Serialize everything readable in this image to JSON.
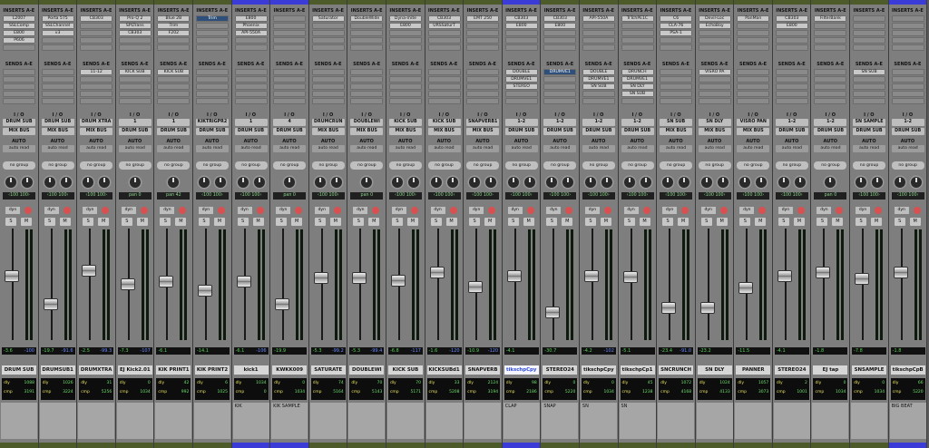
{
  "section_labels": {
    "inserts": "INSERTS A-E",
    "sends": "SENDS A-E",
    "io": "I / O",
    "dyn": "dyn",
    "solo": "S",
    "mute": "M",
    "dly": "dly",
    "cmp": "cmp"
  },
  "colors": {
    "blue": "#3b3bd8",
    "olive": "#4d5a2a",
    "sel": "#2d4f7a"
  },
  "tracks": [
    {
      "name": "DRUM SUB",
      "bar": "olive",
      "inserts": [
        "L2007",
        "SSLComp",
        "E800",
        "P606"
      ],
      "sends": [],
      "input": "DRUM SUB",
      "output": "MIX BUS",
      "auto": "AUTO",
      "mode": "auto read",
      "group": "no group",
      "pan": "‹100  100›",
      "vol": "-3.6",
      "peak": "-100",
      "fader": 0.58,
      "dly": "1088",
      "cmp": "3191",
      "dly2": "1024",
      "cmp2": "3191",
      "comment": ""
    },
    {
      "name": "DRUMSUB1",
      "bar": "olive",
      "inserts": [
        "Porta 575",
        "SSLChannel",
        "v3"
      ],
      "sends": [],
      "input": "DRUM SUB",
      "output": "MIX BUS",
      "auto": "AUTO",
      "mode": "auto read",
      "group": "no group",
      "pan": "‹100  100›",
      "vol": "-19.7",
      "peak": "-91.6",
      "fader": 0.3,
      "dly": "1026",
      "cmp": "3224",
      "comment": ""
    },
    {
      "name": "DRUMXTRA",
      "bar": "olive",
      "inserts": [
        "CB303"
      ],
      "sends": [
        "11-12"
      ],
      "input": "DRUM XTRA",
      "output": "MIX BUS",
      "auto": "AUTO",
      "mode": "auto read",
      "group": "no group",
      "pan": "‹100  100›",
      "vol": "-2.5",
      "peak": "-99.3",
      "fader": 0.63,
      "dly": "31",
      "cmp": "5256",
      "comment": ""
    },
    {
      "name": "EJ Kick2.01",
      "bar": "olive",
      "inserts": [
        "Pro-Q 2",
        "SPLTrans",
        "CB303"
      ],
      "sends": [
        "KICK SUB"
      ],
      "input": "1",
      "output": "DRUM SUB",
      "auto": "AUTO",
      "mode": "auto read",
      "group": "no group",
      "pan": "pan  0",
      "vol": "-7.3",
      "peak": "-107",
      "fader": 0.5,
      "dly": "0",
      "cmp": "1034",
      "comment": ""
    },
    {
      "name": "KIK PRINT1",
      "bar": "olive",
      "inserts": [
        "Blue 2B",
        "Trim",
        "F202"
      ],
      "sends": [
        "KICK SUB"
      ],
      "input": "1",
      "output": "DRUM SUB",
      "auto": "AUTO",
      "mode": "auto read",
      "group": "no group",
      "pan": "pan  42",
      "vol": "-6.1",
      "peak": "",
      "fader": 0.53,
      "dly": "42",
      "cmp": "992",
      "comment": ""
    },
    {
      "name": "KIK PRINT2",
      "bar": "olive",
      "inserts": [
        "Trim"
      ],
      "sends": [],
      "input": "KIKTRIGPR2",
      "output": "DRUM SUB",
      "auto": "AUTO",
      "mode": "auto read",
      "group": "no group",
      "pan": "‹100  100›",
      "vol": "-14.1",
      "peak": "",
      "fader": 0.44,
      "dly": "6",
      "cmp": "1025",
      "comment": "",
      "selIns": true
    },
    {
      "name": "kick1",
      "bar": "blue",
      "inserts": [
        "E800",
        "Phoenix",
        "API-550A"
      ],
      "sends": [],
      "input": "1",
      "output": "DRUM SUB",
      "auto": "AUTO",
      "mode": "auto read",
      "group": "no group",
      "pan": "‹100  100›",
      "vol": "-6.1",
      "peak": "-106",
      "fader": 0.53,
      "dly": "1034",
      "cmp": "0",
      "comment": "KIK"
    },
    {
      "name": "KWKK009",
      "bar": "blue",
      "inserts": [],
      "sends": [],
      "input": "4",
      "output": "DRUM SUB",
      "auto": "AUTO",
      "mode": "auto read",
      "group": "no group",
      "pan": "pan  0",
      "vol": "-19.9",
      "peak": "",
      "fader": 0.3,
      "dly": "0",
      "cmp": "1034",
      "comment": "KIK SAMPLE"
    },
    {
      "name": "SATURATE",
      "bar": "olive",
      "inserts": [
        "Saturator"
      ],
      "sends": [],
      "input": "DRUMCRUN",
      "output": "MIX BUS",
      "auto": "AUTO",
      "mode": "auto read",
      "group": "no group",
      "pan": "‹100  100›",
      "vol": "-5.3",
      "peak": "-99.2",
      "fader": 0.56,
      "dly": "74",
      "cmp": "5164",
      "comment": ""
    },
    {
      "name": "DOUBLEWI",
      "bar": "olive",
      "inserts": [
        "DoubleWide"
      ],
      "sends": [],
      "input": "DOUBLEWI",
      "output": "MIX BUS",
      "auto": "AUTO",
      "mode": "auto read",
      "group": "no group",
      "pan": "pan  0",
      "vol": "-5.3",
      "peak": "-99.4",
      "fader": 0.56,
      "dly": "70",
      "cmp": "5143",
      "comment": ""
    },
    {
      "name": "KICK SUB",
      "bar": "olive",
      "inserts": [
        "Dyna-mite",
        "E800"
      ],
      "sends": [],
      "input": "KICK SUB",
      "output": "MIX BUS",
      "auto": "AUTO",
      "mode": "auto read",
      "group": "no group",
      "pan": "‹100  100›",
      "vol": "-6.8",
      "peak": "-117",
      "fader": 0.54,
      "dly": "70",
      "cmp": "5171",
      "comment": ""
    },
    {
      "name": "KICKSUBd1",
      "bar": "olive",
      "inserts": [
        "CB303",
        "URSSaturT"
      ],
      "sends": [],
      "input": "KICK SUB",
      "output": "MIX BUS",
      "auto": "AUTO",
      "mode": "auto read",
      "group": "no group",
      "pan": "‹100  100›",
      "vol": "-1.6",
      "peak": "-120",
      "fader": 0.62,
      "dly": "33",
      "cmp": "5208",
      "comment": ""
    },
    {
      "name": "SNAPVERB",
      "bar": "olive",
      "inserts": [
        "EMT 250"
      ],
      "sends": [],
      "input": "SNAPVERB1",
      "output": "MIX BUS",
      "auto": "AUTO",
      "mode": "auto read",
      "group": "no group",
      "pan": "‹100  100›",
      "vol": "-10.9",
      "peak": "-120",
      "fader": 0.47,
      "dly": "2124",
      "cmp": "3194",
      "comment": ""
    },
    {
      "name": "tikschpCpy",
      "bar": "blue",
      "inserts": [
        "CB303",
        "E800"
      ],
      "sends": [
        "DOUBLE",
        "DRUMVE1",
        "STEREO"
      ],
      "input": "1-2",
      "output": "DRUM SUB",
      "auto": "AUTO",
      "mode": "auto read",
      "group": "no group",
      "pan": "‹100  100›",
      "vol": "-4.1",
      "peak": "",
      "fader": 0.58,
      "dly": "98",
      "cmp": "2186",
      "comment": "CLAP",
      "selName": true
    },
    {
      "name": "STEREO24",
      "bar": "olive",
      "inserts": [
        "CB303",
        "E800"
      ],
      "sends": [
        "DRUMVE1"
      ],
      "input": "1-2",
      "output": "DRUM SUB",
      "auto": "AUTO",
      "mode": "auto read",
      "group": "no group",
      "pan": "‹100  100›",
      "vol": "-30.7",
      "peak": "",
      "fader": 0.22,
      "dly": "0",
      "cmp": "5220",
      "comment": "SNAP",
      "selSend": true
    },
    {
      "name": "tikschpCpy",
      "bar": "olive",
      "inserts": [
        "API-550A"
      ],
      "sends": [
        "DOUBLE",
        "DRUMVE1",
        "SN SUB"
      ],
      "input": "1-2",
      "output": "DRUM SUB",
      "auto": "AUTO",
      "mode": "auto read",
      "group": "no group",
      "pan": "‹100  100›",
      "vol": "-4.2",
      "peak": "-102",
      "fader": 0.58,
      "dly": "0",
      "cmp": "1034",
      "comment": "SN"
    },
    {
      "name": "tikschpCp1",
      "bar": "olive",
      "inserts": [
        "TrTchPE1C"
      ],
      "sends": [
        "DRUNCH",
        "DRUMVE1",
        "SN DLY",
        "SN SUB"
      ],
      "input": "1-2",
      "output": "DRUM SUB",
      "auto": "AUTO",
      "mode": "auto read",
      "group": "no group",
      "pan": "‹100  100›",
      "vol": "-5.1",
      "peak": "",
      "fader": 0.57,
      "dly": "45",
      "cmp": "1238",
      "comment": "SN"
    },
    {
      "name": "SNCRUNCH",
      "bar": "olive",
      "inserts": [
        "C6",
        "CLA-76",
        "PSA-1"
      ],
      "sends": [],
      "input": "SN SUB",
      "output": "MIX BUS",
      "auto": "AUTO",
      "mode": "auto read",
      "group": "no group",
      "pan": "‹100  100›",
      "vol": "-23.4",
      "peak": "-91.0",
      "fader": 0.27,
      "dly": "1072",
      "cmp": "4168",
      "comment": ""
    },
    {
      "name": "SN DLY",
      "bar": "olive",
      "inserts": [
        "Devil-Loc",
        "EchoBoy"
      ],
      "sends": [
        "VISRO PA"
      ],
      "input": "SN DLY",
      "output": "MIX BUS",
      "auto": "AUTO",
      "mode": "auto read",
      "group": "no group",
      "pan": "‹100  100›",
      "vol": "-23.2",
      "peak": "",
      "fader": 0.27,
      "dly": "1024",
      "cmp": "4133",
      "comment": ""
    },
    {
      "name": "PANNER",
      "bar": "olive",
      "inserts": [
        "PanMan"
      ],
      "sends": [],
      "input": "VISRO PAN",
      "output": "MIX BUS",
      "auto": "AUTO",
      "mode": "auto read",
      "group": "no group",
      "pan": "‹100  100›",
      "vol": "-11.5",
      "peak": "",
      "fader": 0.46,
      "dly": "1057",
      "cmp": "3073",
      "comment": ""
    },
    {
      "name": "STEREO24",
      "bar": "olive",
      "inserts": [
        "CB303",
        "E800"
      ],
      "sends": [],
      "input": "1-2",
      "output": "DRUM SUB",
      "auto": "AUTO",
      "mode": "auto read",
      "group": "no group",
      "pan": "‹100  100›",
      "vol": "-4.1",
      "peak": "",
      "fader": 0.58,
      "dly": "2",
      "cmp": "1001",
      "comment": ""
    },
    {
      "name": "EJ tap",
      "bar": "olive",
      "inserts": [
        "FilterBank"
      ],
      "sends": [],
      "input": "1-2",
      "output": "DRUM SUB",
      "auto": "AUTO",
      "mode": "auto read",
      "group": "no group",
      "pan": "pan  0",
      "vol": "-1.8",
      "peak": "",
      "fader": 0.62,
      "dly": "0",
      "cmp": "1034",
      "comment": ""
    },
    {
      "name": "SNSAMPLE",
      "bar": "olive",
      "inserts": [],
      "sends": [
        "SN SUB"
      ],
      "input": "SN SAMPLE",
      "output": "DRUM SUB",
      "auto": "AUTO",
      "mode": "auto read",
      "group": "no group",
      "pan": "‹100  100›",
      "vol": "-7.8",
      "peak": "",
      "fader": 0.55,
      "dly": "0",
      "cmp": "1034",
      "comment": ""
    },
    {
      "name": "tikschpCpB",
      "bar": "blue",
      "inserts": [],
      "sends": [],
      "input": "1-2",
      "output": "DRUM SUB",
      "auto": "AUTO",
      "mode": "auto read",
      "group": "no group",
      "pan": "‹100  100›",
      "vol": "-1.8",
      "peak": "",
      "fader": 0.62,
      "dly": "66",
      "cmp": "5220",
      "comment": "BIG BEAT"
    }
  ]
}
